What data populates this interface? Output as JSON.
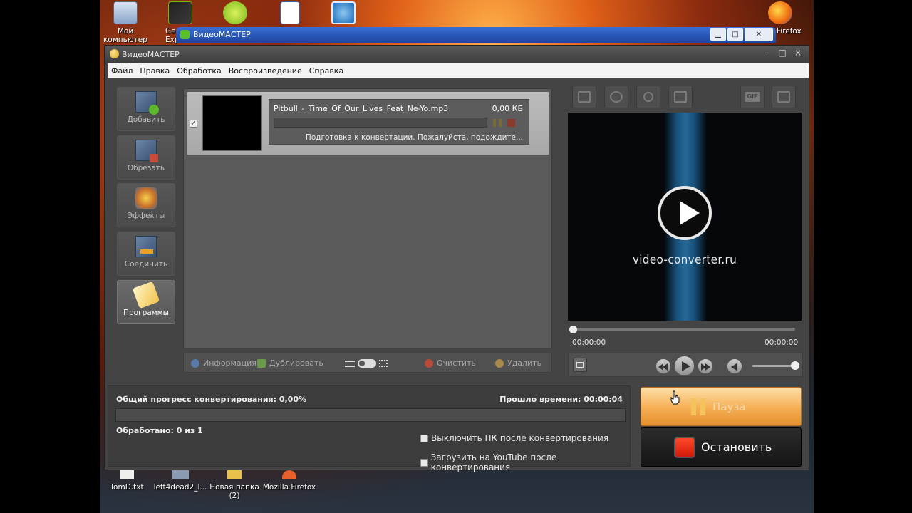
{
  "desktop": {
    "top_icons": [
      {
        "label": "Мой компьютер"
      },
      {
        "label": "Ge Expe"
      },
      {
        "label": ""
      },
      {
        "label": ""
      },
      {
        "label": ""
      },
      {
        "label": "Firefox"
      }
    ],
    "bottom_icons": [
      {
        "label": "TomD.txt"
      },
      {
        "label": "left4dead2_l..."
      },
      {
        "label": "Новая папка (2)"
      },
      {
        "label": "Mozilla Firefox"
      }
    ]
  },
  "bg_window": {
    "title": "ВидеоМАСТЕР"
  },
  "window": {
    "title": "ВидеоМАСТЕР",
    "controls": [
      "–",
      "□",
      "×"
    ]
  },
  "menu": [
    "Файл",
    "Правка",
    "Обработка",
    "Воспроизведение",
    "Справка"
  ],
  "left_toolbar": [
    {
      "label": "Добавить",
      "icon": "film-add-icon"
    },
    {
      "label": "Обрезать",
      "icon": "film-cut-icon"
    },
    {
      "label": "Эффекты",
      "icon": "effects-icon"
    },
    {
      "label": "Соединить",
      "icon": "film-join-icon"
    },
    {
      "label": "Программы",
      "icon": "programs-icon"
    }
  ],
  "file": {
    "checked": true,
    "name": "Pitbull_-_Time_Of_Our_Lives_Feat_Ne-Yo.mp3",
    "size": "0,00 КБ",
    "status": "Подготовка к конвертации. Пожалуйста, подождите...",
    "progress": 0
  },
  "list_toolbar": {
    "info": "Информация",
    "duplicate": "Дублировать",
    "clear": "Очистить",
    "delete": "Удалить"
  },
  "preview": {
    "tools": [
      "crop-icon",
      "rotate-icon",
      "brightness-icon",
      "frame-icon",
      "gif-icon",
      "fullscreen-icon"
    ],
    "gif_label": "GIF",
    "brand": "video-converter.ru",
    "time_start": "00:00:00",
    "time_end": "00:00:00",
    "volume": 1.0
  },
  "progress": {
    "title": "Общий прогресс конвертирования: 0,00%",
    "elapsed": "Прошло времени: 00:00:04",
    "processed": "Обработано: 0 из 1",
    "percent": 0,
    "opt_shutdown": "Выключить ПК после конвертирования",
    "opt_youtube": "Загрузить на YouTube после конвертирования"
  },
  "actions": {
    "pause": "Пауза",
    "stop": "Остановить"
  },
  "colors": {
    "pause_accent": "#f7b25a",
    "stop_accent": "#e02a12",
    "preview_beam": "#2a7ab2"
  }
}
